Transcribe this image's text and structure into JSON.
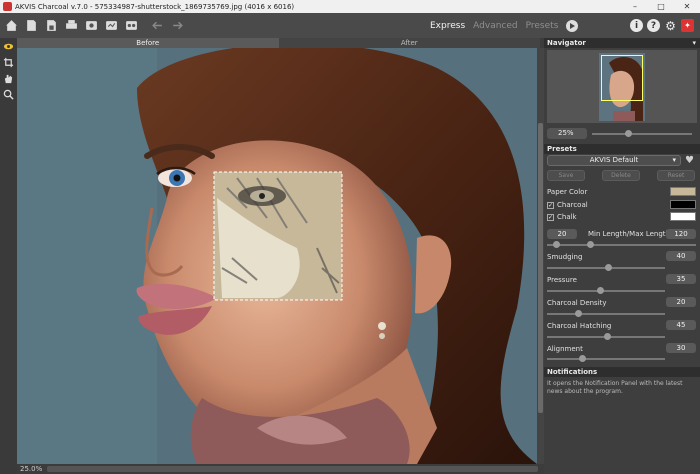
{
  "window": {
    "title": "AKVIS Charcoal v.7.0 - 575334987-shutterstock_1869735769.jpg (4016 x 6016)"
  },
  "modes": {
    "express": "Express",
    "advanced": "Advanced",
    "presets": "Presets"
  },
  "tabs": {
    "before": "Before",
    "after": "After"
  },
  "status": {
    "zoom": "25.0%"
  },
  "panel": {
    "navigator": {
      "title": "Navigator",
      "zoom": "25%",
      "zoom_fraction": 0.35
    },
    "presets": {
      "title": "Presets",
      "selected": "AKVIS Default",
      "save": "Save",
      "delete": "Delete",
      "reset": "Reset"
    },
    "params": {
      "paper_color_label": "Paper Color",
      "paper_color": "#c8b89a",
      "charcoal_label": "Charcoal",
      "charcoal_color": "#000000",
      "chalk_label": "Chalk",
      "chalk_color": "#ffffff",
      "length_label": "Min Length/Max Length",
      "min_length": "20",
      "max_length": "120",
      "smudging_label": "Smudging",
      "smudging": "40",
      "pressure_label": "Pressure",
      "pressure": "35",
      "density_label": "Charcoal Density",
      "density": "20",
      "hatching_label": "Charcoal Hatching",
      "hatching": "45",
      "alignment_label": "Alignment",
      "alignment": "30"
    },
    "notifications": {
      "title": "Notifications",
      "text": "It opens the Notification Panel with the latest news about the program."
    }
  },
  "icons": [
    "open-icon",
    "save-icon",
    "print-icon",
    "share-icon",
    "batch-icon",
    "settings-icon",
    "undo-icon",
    "redo-icon",
    "run-icon",
    "info-icon",
    "help-icon",
    "gear-icon",
    "gift-icon",
    "eye-icon",
    "crop-icon",
    "hand-icon",
    "zoom-icon"
  ],
  "colors": {
    "accent": "#d33333",
    "canvas_bg": "#56717d",
    "paper": "#c8b89a"
  }
}
